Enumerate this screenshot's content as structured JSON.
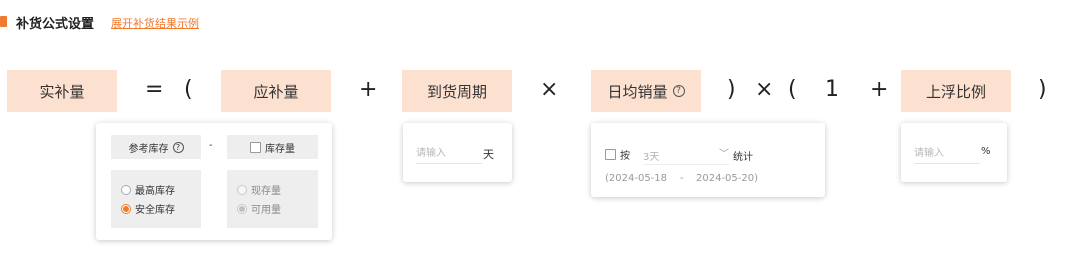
{
  "header": {
    "title": "补货公式设置",
    "expand_link": "展开补货结果示例"
  },
  "formula": {
    "result": "实补量",
    "equals": "=",
    "open_paren": "(",
    "term_replenish": "应补量",
    "plus1": "+",
    "term_arrival": "到货周期",
    "times1": "×",
    "term_daily_sales": "日均销量",
    "close_paren_times": ")",
    "times2": "×",
    "open_paren2": "(",
    "one": "1",
    "plus2": "+",
    "term_float": "上浮比例",
    "close_paren2": ")"
  },
  "replenish_card": {
    "ref_stock_label": "参考库存",
    "minus": "-",
    "stock_qty_label": "库存量",
    "stock_qty_checked": false,
    "left_options": [
      {
        "label": "最高库存",
        "selected": false
      },
      {
        "label": "安全库存",
        "selected": true
      }
    ],
    "right_options": [
      {
        "label": "现存量",
        "selected": false,
        "disabled": true
      },
      {
        "label": "可用量",
        "selected": true,
        "disabled": true
      }
    ]
  },
  "arrival_card": {
    "placeholder": "请输入",
    "unit": "天"
  },
  "daily_sales_card": {
    "by_label": "按",
    "by_checked": false,
    "period_value": "3天",
    "stat_label": "统计",
    "date_start": "(2024-05-18",
    "date_sep": "-",
    "date_end": "2024-05-20)"
  },
  "float_card": {
    "placeholder": "请输入",
    "unit": "%"
  },
  "colors": {
    "accent": "#f07a2e",
    "block_bg": "#fde1d0"
  },
  "icons": [
    "header-marker-icon",
    "help-icon",
    "chevron-down-icon",
    "radio-icon",
    "checkbox-icon"
  ]
}
